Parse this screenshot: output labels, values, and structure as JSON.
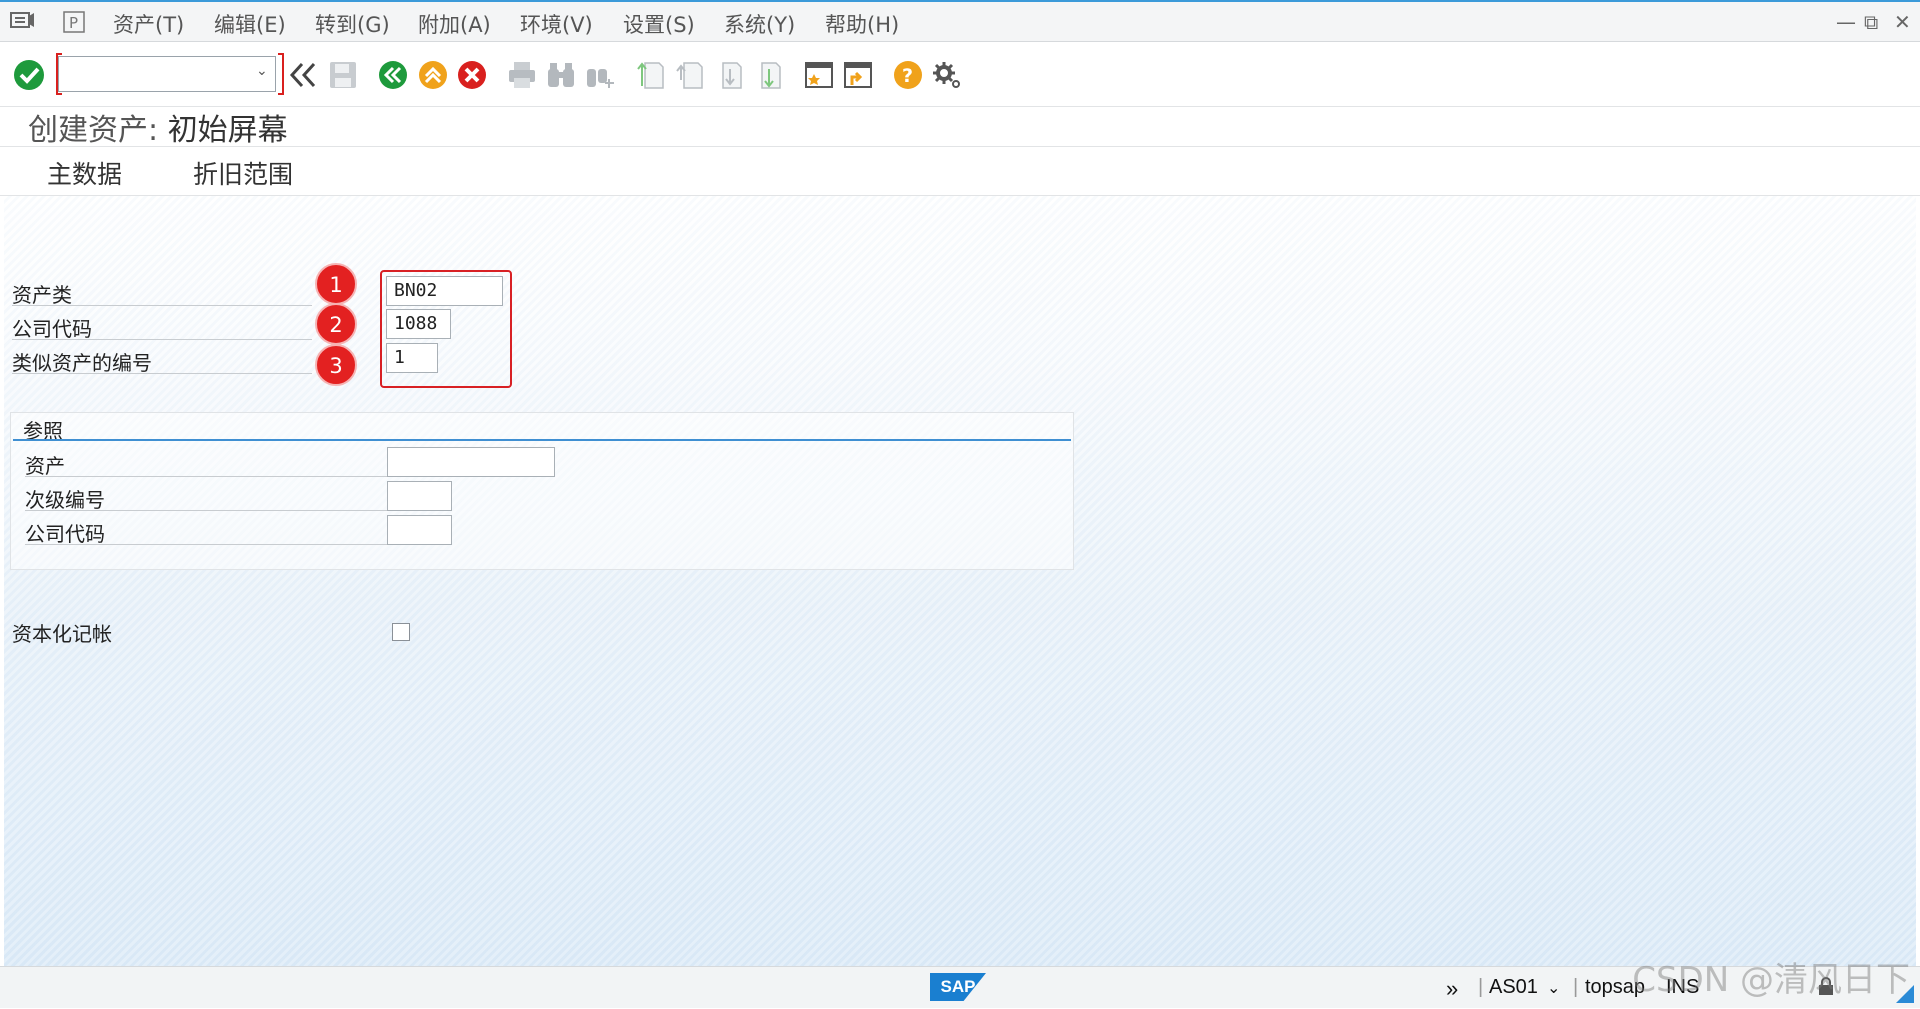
{
  "menu": {
    "items": [
      "资产(T)",
      "编辑(E)",
      "转到(G)",
      "附加(A)",
      "环境(V)",
      "设置(S)",
      "系统(Y)",
      "帮助(H)"
    ]
  },
  "toolbar": {
    "command_field_value": "",
    "icons": [
      "enter-check",
      "back",
      "save",
      "back-green",
      "exit-up",
      "cancel",
      "print",
      "find",
      "find-next",
      "first-page",
      "prev-page",
      "next-page",
      "last-page",
      "new-session",
      "shortcut",
      "help",
      "customize"
    ]
  },
  "title": {
    "prefix": "创建资产:",
    "main": "初始屏幕"
  },
  "tabs": [
    "主数据",
    "折旧范围"
  ],
  "form": {
    "asset_class": {
      "label": "资产类",
      "value": "BN02"
    },
    "company_code": {
      "label": "公司代码",
      "value": "1088"
    },
    "similar_count": {
      "label": "类似资产的编号",
      "value": "1"
    }
  },
  "annotations": [
    "1",
    "2",
    "3"
  ],
  "reference": {
    "title": "参照",
    "asset": {
      "label": "资产",
      "value": ""
    },
    "subnumber": {
      "label": "次级编号",
      "value": ""
    },
    "company_code": {
      "label": "公司代码",
      "value": ""
    }
  },
  "capitalization": {
    "label": "资本化记帐",
    "checked": false
  },
  "statusbar": {
    "logo": "SAP",
    "transaction": "AS01",
    "server": "topsap",
    "mode": "INS"
  },
  "watermark": "CSDN @清风日下",
  "colors": {
    "accent": "#3f8fd2",
    "highlight": "#d82024",
    "badge": "#e32121"
  }
}
